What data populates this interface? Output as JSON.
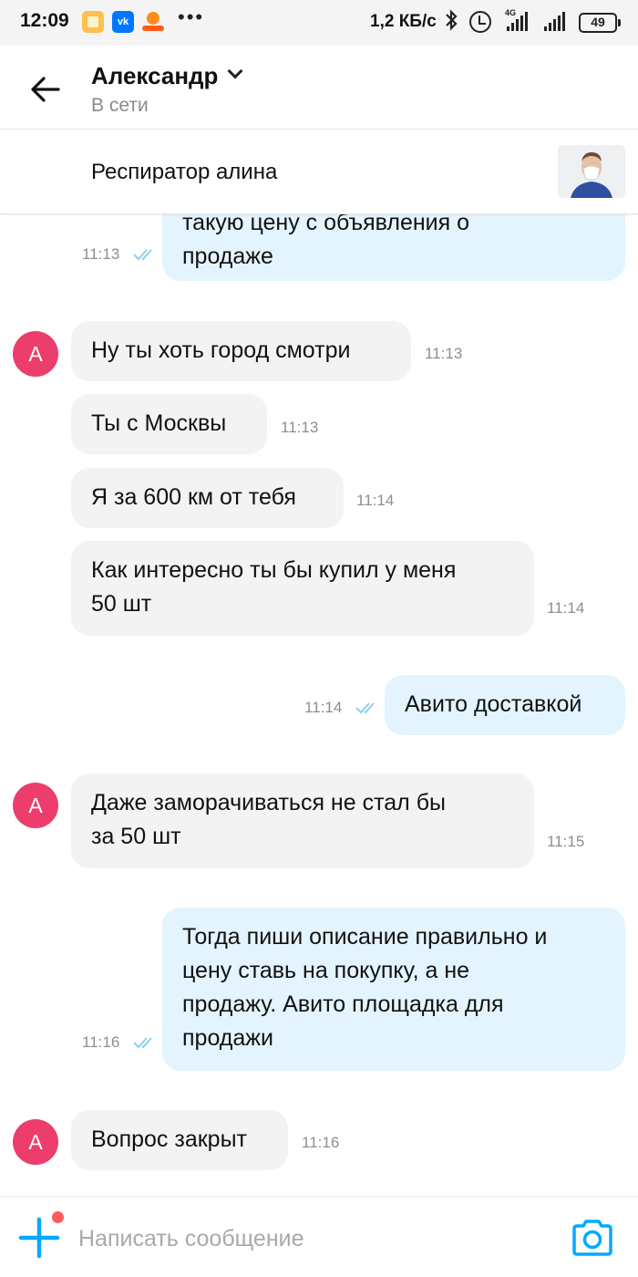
{
  "status_bar": {
    "time": "12:09",
    "vk_label": "vk",
    "dots": "•••",
    "net_speed": "1,2 КБ/с",
    "network_type": "4G",
    "battery": "49",
    "icons": [
      "notes-app-icon",
      "vk-app-icon",
      "ok-app-icon",
      "bluetooth-icon",
      "alarm-icon",
      "signal-icon",
      "battery-icon"
    ]
  },
  "header": {
    "back_icon": "arrow-left-icon",
    "contact_name": "Александр",
    "status": "В сети"
  },
  "listing": {
    "title": "Респиратор алина"
  },
  "messages": [
    {
      "dir": "out",
      "lines": [
        "такую цену с объявления о",
        "продаже"
      ],
      "time": "11:13",
      "read": true
    },
    {
      "dir": "in",
      "avatar": "А",
      "text": "Ну ты хоть город смотри",
      "time": "11:13"
    },
    {
      "dir": "in",
      "text": "Ты с Москвы",
      "time": "11:13"
    },
    {
      "dir": "in",
      "text": "Я за 600 км от тебя",
      "time": "11:14"
    },
    {
      "dir": "in",
      "lines": [
        "Как интересно ты бы купил у меня",
        "50 шт"
      ],
      "time": "11:14"
    },
    {
      "dir": "out",
      "text": "Авито доставкой",
      "time": "11:14",
      "read": true
    },
    {
      "dir": "in",
      "avatar": "А",
      "lines": [
        "Даже заморачиваться не стал бы",
        "за 50 шт"
      ],
      "time": "11:15"
    },
    {
      "dir": "out",
      "lines": [
        "Тогда пиши описание правильно и",
        "цену ставь на покупку, а не",
        "продажу. Авито площадка для",
        "продажи"
      ],
      "time": "11:16",
      "read": true
    },
    {
      "dir": "in",
      "avatar": "А",
      "text": "Вопрос закрыт",
      "time": "11:16"
    }
  ],
  "composer": {
    "placeholder": "Написать сообщение",
    "value": "",
    "attach_icon": "plus-icon",
    "camera_icon": "camera-icon"
  },
  "colors": {
    "accent": "#00aaff",
    "outgoing_bubble": "#e3f4fe",
    "incoming_bubble": "#f3f3f3",
    "avatar": "#ec3d6d",
    "read_ticks": "#8ecff0"
  }
}
